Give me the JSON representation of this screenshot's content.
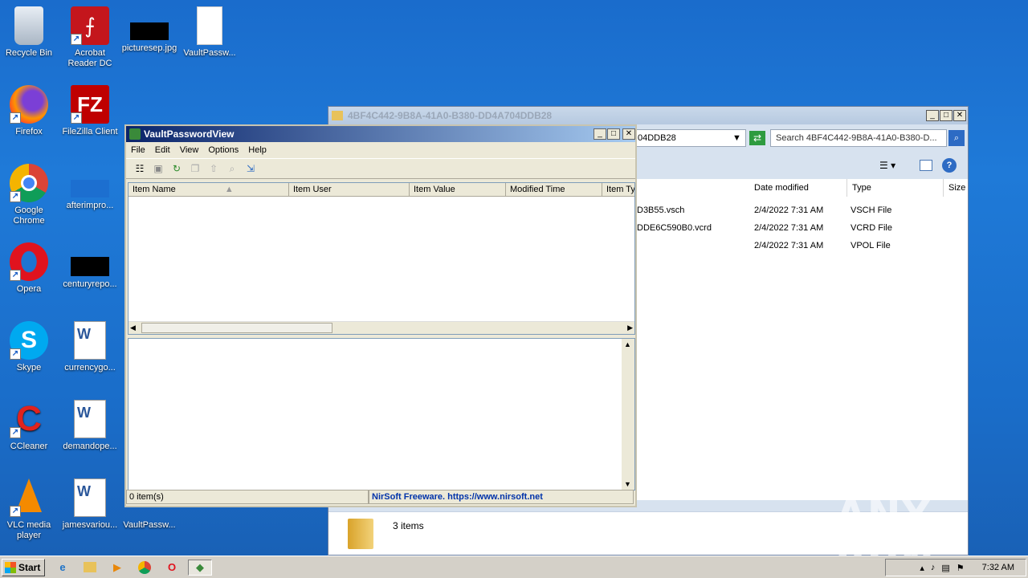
{
  "desktop": {
    "icons": [
      {
        "label": "Recycle Bin",
        "icon": "recycle-bin-icon"
      },
      {
        "label": "Acrobat Reader DC",
        "icon": "acrobat-icon"
      },
      {
        "label": "picturesep.jpg",
        "icon": "image-file-icon"
      },
      {
        "label": "VaultPassw...",
        "icon": "file-icon"
      },
      {
        "label": "Firefox",
        "icon": "firefox-icon"
      },
      {
        "label": "FileZilla Client",
        "icon": "filezilla-icon"
      },
      {
        "label": "Google Chrome",
        "icon": "chrome-icon"
      },
      {
        "label": "afterimpro...",
        "icon": "file-icon"
      },
      {
        "label": "Opera",
        "icon": "opera-icon"
      },
      {
        "label": "centuryrepo...",
        "icon": "image-file-icon"
      },
      {
        "label": "Skype",
        "icon": "skype-icon"
      },
      {
        "label": "currencygo...",
        "icon": "word-doc-icon"
      },
      {
        "label": "CCleaner",
        "icon": "ccleaner-icon"
      },
      {
        "label": "demandope...",
        "icon": "word-doc-icon"
      },
      {
        "label": "VLC media player",
        "icon": "vlc-icon"
      },
      {
        "label": "jamesvariou...",
        "icon": "word-doc-icon"
      },
      {
        "label": "VaultPassw...",
        "icon": "vaultpasswordview-icon"
      }
    ]
  },
  "explorer": {
    "title": "4BF4C442-9B8A-41A0-B380-DD4A704DDB28",
    "address_tail": "04DDB28",
    "search_placeholder": "Search 4BF4C442-9B8A-41A0-B380-D...",
    "columns": {
      "date": "Date modified",
      "type": "Type",
      "size": "Size"
    },
    "files": [
      {
        "name": "D3B55.vsch",
        "date": "2/4/2022 7:31 AM",
        "type": "VSCH File"
      },
      {
        "name": "DDE6C590B0.vcrd",
        "date": "2/4/2022 7:31 AM",
        "type": "VCRD File"
      },
      {
        "name": "",
        "date": "2/4/2022 7:31 AM",
        "type": "VPOL File"
      }
    ],
    "item_count": "3 items"
  },
  "vault": {
    "title": "VaultPasswordView",
    "menu": [
      "File",
      "Edit",
      "View",
      "Options",
      "Help"
    ],
    "columns": [
      "Item Name",
      "Item User",
      "Item Value",
      "Modified Time",
      "Item Ty"
    ],
    "status_count": "0 item(s)",
    "status_link": "NirSoft Freeware. https://www.nirsoft.net"
  },
  "taskbar": {
    "start_label": "Start",
    "clock": "7:32 AM"
  },
  "watermark": "ANY RUN"
}
